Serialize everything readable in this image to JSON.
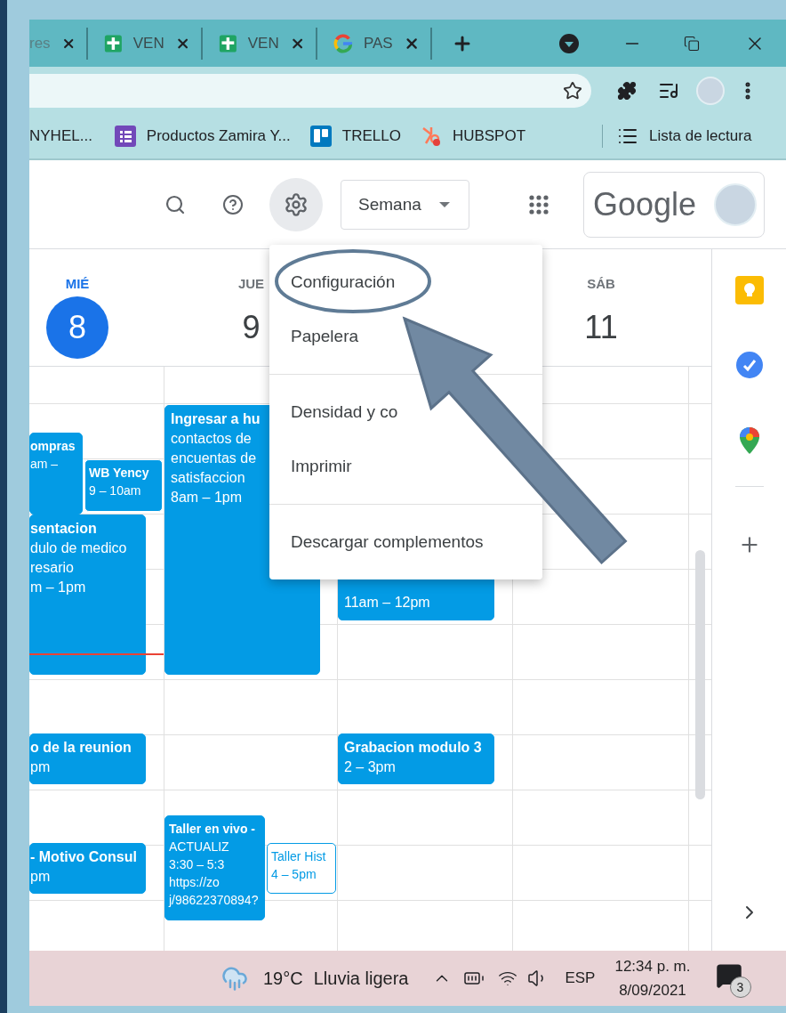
{
  "browser": {
    "tabs": [
      {
        "title": "res",
        "kind": "faded"
      },
      {
        "title": "VEN",
        "kind": "sheets"
      },
      {
        "title": "VEN",
        "kind": "sheets"
      },
      {
        "title": "PAS",
        "kind": "google"
      }
    ],
    "bookmarks": [
      {
        "label": "NYHEL...",
        "kind": "text"
      },
      {
        "label": "Productos Zamira Y...",
        "kind": "forms"
      },
      {
        "label": "TRELLO",
        "kind": "trello"
      },
      {
        "label": "HUBSPOT",
        "kind": "hubspot"
      }
    ],
    "reading_list": "Lista de lectura"
  },
  "calendar": {
    "view": "Semana",
    "logo": "Google",
    "days": [
      {
        "weekday": "MIÉ",
        "date": "8",
        "today": true,
        "events": [
          {
            "lines": [
              "ompras",
              "am –"
            ],
            "kind": "filled"
          },
          {
            "lines": [
              "WB Yency",
              "9 – 10am"
            ],
            "kind": "bordered"
          },
          {
            "lines": [
              "sentacion",
              "dulo de medico",
              "resario",
              "m – 1pm"
            ],
            "kind": "filled"
          },
          {
            "lines": [
              "o de la reunion",
              "pm"
            ],
            "kind": "filled"
          },
          {
            "lines": [
              "- Motivo Consul",
              "pm"
            ],
            "kind": "filled"
          }
        ]
      },
      {
        "weekday": "JUE",
        "date": "9",
        "today": false,
        "events": [
          {
            "lines": [
              "Ingresar a hu",
              "contactos de",
              "encuentas de",
              "satisfaccion",
              "8am – 1pm"
            ],
            "kind": "filled"
          },
          {
            "lines": [
              "Taller en vivo -",
              "ACTUALIZ",
              "3:30 – 5:3",
              "https://zo",
              "j/98622370894?"
            ],
            "kind": "filled"
          },
          {
            "lines": [
              "Taller Hist",
              "4 – 5pm"
            ],
            "kind": "outlined"
          }
        ]
      },
      {
        "events": [
          {
            "lines": [
              "11am – 12pm"
            ],
            "kind": "filled"
          },
          {
            "lines": [
              "Grabacion modulo 3",
              "2 – 3pm"
            ],
            "kind": "filled"
          }
        ]
      },
      {
        "weekday": "SÁB",
        "date": "11",
        "today": false
      }
    ],
    "menu": [
      [
        "Configuración",
        "Papelera"
      ],
      [
        "Densidad y co",
        "Imprimir"
      ],
      [
        "Descargar complementos"
      ]
    ]
  },
  "taskbar": {
    "temperature": "19°C",
    "weather": "Lluvia ligera",
    "language": "ESP",
    "time": "12:34 p. m.",
    "date": "8/09/2021",
    "notifications": "3"
  }
}
